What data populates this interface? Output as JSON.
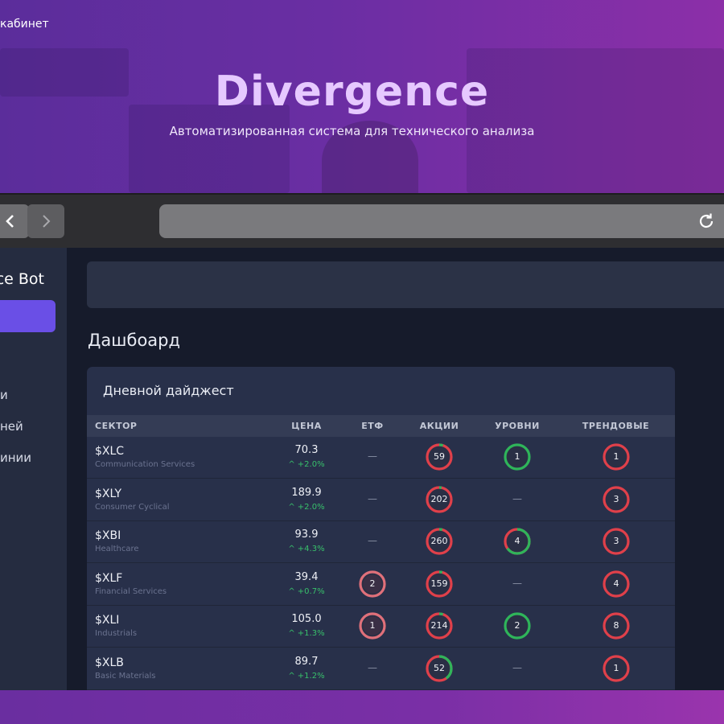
{
  "hero": {
    "cabinet_link": "кабинет",
    "title": "Divergence",
    "subtitle": "Автоматизированная система для технического анализа"
  },
  "browser": {
    "back_icon": "chevron-left-icon",
    "forward_icon": "chevron-right-icon",
    "reload_icon": "reload-icon",
    "url": ""
  },
  "sidebar": {
    "brand": "ce Bot",
    "items": [
      {
        "label": "и"
      },
      {
        "label": "ней"
      },
      {
        "label": "инии"
      }
    ]
  },
  "main": {
    "page_title": "Дашбоард",
    "card_title": "Дневной дайджест",
    "columns": [
      "СЕКТОР",
      "ЦЕНА",
      "ЕТФ",
      "АКЦИИ",
      "УРОВНИ",
      "ТРЕНДОВЫЕ"
    ],
    "rows": [
      {
        "ticker": "$XLC",
        "sector": "Communication Services",
        "price": "70.3",
        "change": "+2.0%",
        "etf": null,
        "stocks": "59",
        "stocks_green_fraction": 0.05,
        "levels": "1",
        "levels_color": "green",
        "trend": "1"
      },
      {
        "ticker": "$XLY",
        "sector": "Consumer Cyclical",
        "price": "189.9",
        "change": "+2.0%",
        "etf": null,
        "stocks": "202",
        "stocks_green_fraction": 0.03,
        "levels": null,
        "levels_color": null,
        "trend": "3"
      },
      {
        "ticker": "$XBI",
        "sector": "Healthcare",
        "price": "93.9",
        "change": "+4.3%",
        "etf": null,
        "stocks": "260",
        "stocks_green_fraction": 0.04,
        "levels": "4",
        "levels_color": "mixed",
        "trend": "3"
      },
      {
        "ticker": "$XLF",
        "sector": "Financial Services",
        "price": "39.4",
        "change": "+0.7%",
        "etf": "2",
        "stocks": "159",
        "stocks_green_fraction": 0.04,
        "levels": null,
        "levels_color": null,
        "trend": "4"
      },
      {
        "ticker": "$XLI",
        "sector": "Industrials",
        "price": "105.0",
        "change": "+1.3%",
        "etf": "1",
        "stocks": "214",
        "stocks_green_fraction": 0.05,
        "levels": "2",
        "levels_color": "green",
        "trend": "8"
      },
      {
        "ticker": "$XLB",
        "sector": "Basic Materials",
        "price": "89.7",
        "change": "+1.2%",
        "etf": null,
        "stocks": "52",
        "stocks_green_fraction": 0.4,
        "levels": null,
        "levels_color": null,
        "trend": "1"
      }
    ],
    "dash_symbol": "—",
    "up_arrow": "^"
  },
  "colors": {
    "red": "#e0404a",
    "green": "#2fb55a",
    "accent": "#6a4fe6"
  }
}
